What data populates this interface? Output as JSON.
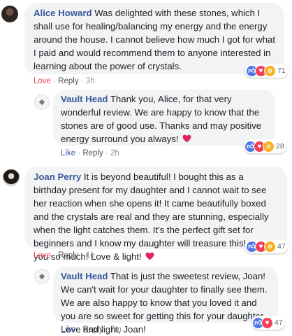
{
  "comments": [
    {
      "author": "Alice Howard",
      "text": "Was delighted with these stones, which I shall use for healing/balancing my energy and the energy around the house. I cannot believe how much I got for what I paid and would recommend them to anyone interested in learning about the power of crystals.",
      "action_like": "Love",
      "action_reply": "Reply",
      "time": "3h",
      "reaction_count": "71"
    },
    {
      "author": "Vault Head",
      "text": "Thank you, Alice, for that very wonderful review. We are happy to know that the stones are of good use. Thanks and may positive energy surround you always!",
      "action_like": "Like",
      "action_reply": "Reply",
      "time": "2h",
      "reaction_count": "28"
    },
    {
      "author": "Joan Perry",
      "text": "It is beyond beautiful! I bought this as a birthday present for my daughter and I cannot wait to see her reaction when she opens it! It came beautifully boxed and the crystals are real and they are stunning, especially when the light catches them. It's the perfect gift set for beginners and I know my daughter will treasure this! Thank you so much! Love & light!",
      "action_like": "Love",
      "action_reply": "Reply",
      "time": "1h",
      "reaction_count": "47"
    },
    {
      "author": "Vault Head",
      "text": "That is just the sweetest review, Joan! We can't wait for your daughter to finally see them. We are also happy to know that you loved it and you are so sweet for getting this for your daughter. Love and light, Joan!",
      "action_like": "Like",
      "action_reply": "Reply",
      "time": "7m",
      "reaction_count": "47"
    }
  ],
  "separator": "·",
  "icons": {
    "like": "like-icon",
    "love": "love-icon",
    "wow": "wow-icon",
    "heart": "heart-icon"
  },
  "colors": {
    "author": "#385898",
    "bubble": "#f2f3f5",
    "love": "#f33e58",
    "like": "#4a76e6",
    "wow": "#f7b125"
  }
}
